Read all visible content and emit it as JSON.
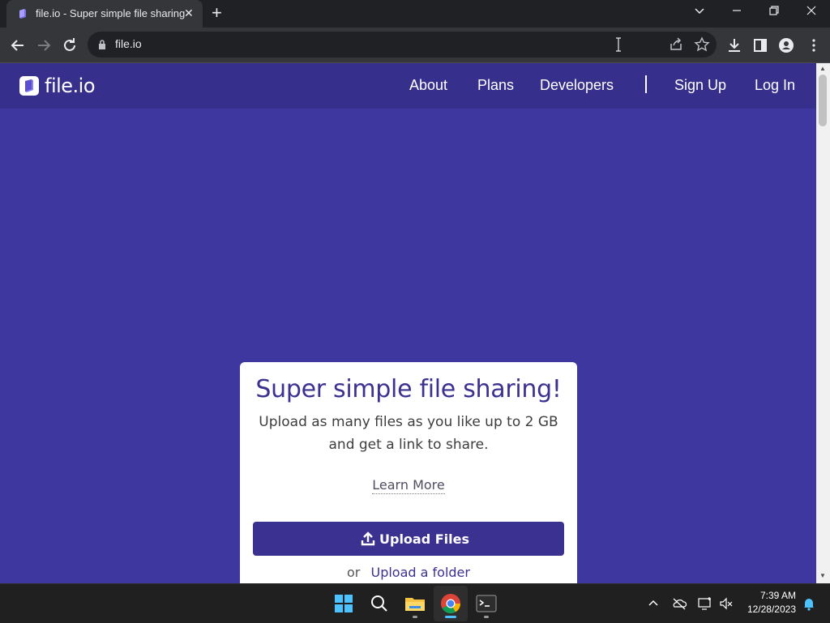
{
  "browser": {
    "tab_title": "file.io - Super simple file sharing",
    "url": "file.io"
  },
  "site": {
    "logo_text": "file.io",
    "nav": {
      "about": "About",
      "plans": "Plans",
      "developers": "Developers",
      "sign_up": "Sign Up",
      "log_in": "Log In"
    },
    "card": {
      "title": "Super simple file sharing!",
      "description": "Upload as many files as you like up to 2 GB and get a link to share.",
      "learn_more": "Learn More",
      "upload_button": "Upload Files",
      "or_text": "or",
      "upload_folder": "Upload a folder"
    }
  },
  "taskbar": {
    "time": "7:39 AM",
    "date": "12/28/2023"
  },
  "colors": {
    "page_bg": "#3f37a0",
    "nav_bg": "#372f8c",
    "accent": "#3b3190"
  }
}
